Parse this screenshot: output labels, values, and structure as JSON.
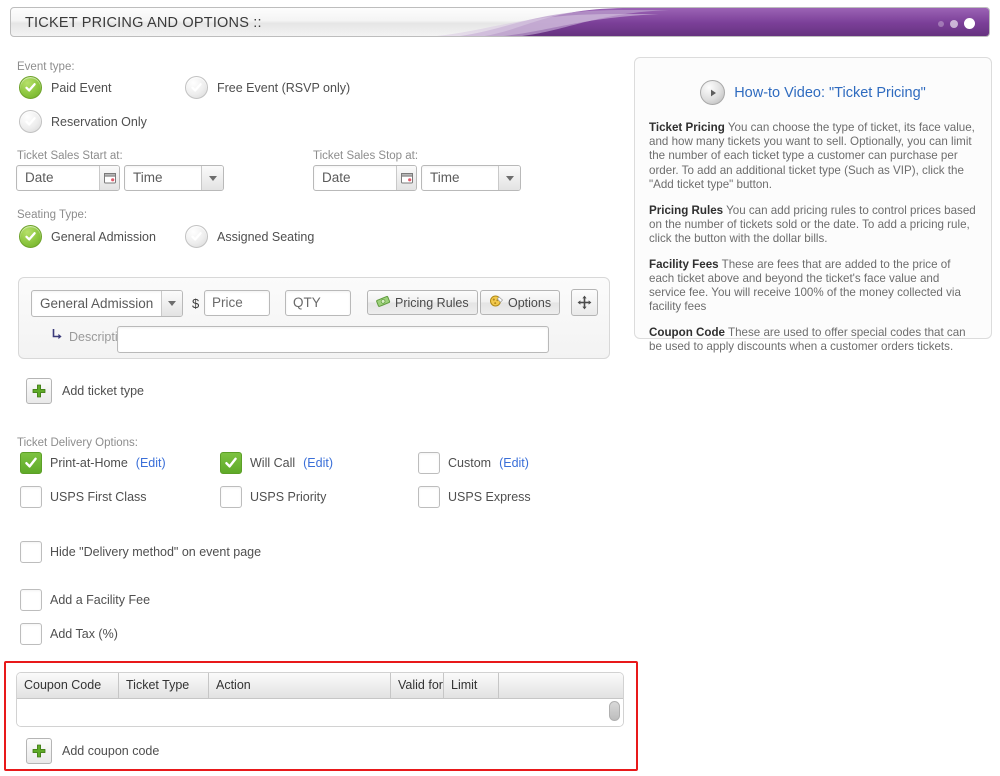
{
  "header": {
    "title": "TICKET PRICING AND OPTIONS ::",
    "accent_color": "#7b3f98",
    "dots": [
      "dot-faint",
      "dot-medium",
      "dot-bright"
    ]
  },
  "event_type": {
    "label": "Event type:",
    "options": [
      {
        "label": "Paid Event",
        "selected": true
      },
      {
        "label": "Free Event (RSVP only)",
        "selected": false
      },
      {
        "label": "Reservation Only",
        "selected": false
      }
    ]
  },
  "sales_window": {
    "start_label": "Ticket Sales Start at:",
    "stop_label": "Ticket Sales Stop at:",
    "start_date_placeholder": "Date",
    "start_time_placeholder": "Time",
    "stop_date_placeholder": "Date",
    "stop_time_placeholder": "Time"
  },
  "seating_type": {
    "label": "Seating Type:",
    "options": [
      {
        "label": "General Admission",
        "selected": true
      },
      {
        "label": "Assigned Seating",
        "selected": false
      }
    ]
  },
  "ticket_row": {
    "type_value": "General Admission",
    "currency": "$",
    "price_placeholder": "Price",
    "qty_placeholder": "QTY",
    "pricing_rules_label": "Pricing Rules",
    "options_label": "Options",
    "description_label": "Description",
    "description_value": ""
  },
  "add_ticket_type_label": "Add ticket type",
  "delivery": {
    "label": "Ticket Delivery Options:",
    "items": [
      {
        "label": "Print-at-Home",
        "edit": "(Edit)",
        "checked": true
      },
      {
        "label": "Will Call",
        "edit": "(Edit)",
        "checked": true
      },
      {
        "label": "Custom",
        "edit": "(Edit)",
        "checked": false
      },
      {
        "label": "USPS First Class",
        "edit": "",
        "checked": false
      },
      {
        "label": "USPS Priority",
        "edit": "",
        "checked": false
      },
      {
        "label": "USPS Express",
        "edit": "",
        "checked": false
      }
    ]
  },
  "extra_options": [
    {
      "label": "Hide \"Delivery method\" on event page",
      "checked": false
    },
    {
      "label": "Add a Facility Fee",
      "checked": false
    },
    {
      "label": "Add Tax (%)",
      "checked": false
    }
  ],
  "coupon_table": {
    "columns": [
      "Coupon Code",
      "Ticket Type",
      "Action",
      "Valid for",
      "Limit",
      ""
    ],
    "rows": [],
    "add_label": "Add coupon code",
    "highlight_color": "#e8191a"
  },
  "info_panel": {
    "video_label": "How-to Video: \"Ticket Pricing\"",
    "paragraphs": [
      {
        "heading": "Ticket Pricing",
        "body": " You can choose the type of ticket, its face value, and how many tickets you want to sell. Optionally, you can limit the number of each ticket type a customer can purchase per order. To add an additional ticket type (Such as VIP), click the \"Add ticket type\" button."
      },
      {
        "heading": "Pricing Rules",
        "body": " You can add pricing rules to control prices based on the number of tickets sold or the date. To add a pricing rule, click the button with the dollar bills."
      },
      {
        "heading": "Facility Fees",
        "body": " These are fees that are added to the price of each ticket above and beyond the ticket's face value and service fee. You will receive 100% of the money collected via facility fees"
      },
      {
        "heading": "Coupon Code",
        "body": " These are used to offer special codes that can be used to apply discounts when a customer orders tickets."
      }
    ]
  }
}
